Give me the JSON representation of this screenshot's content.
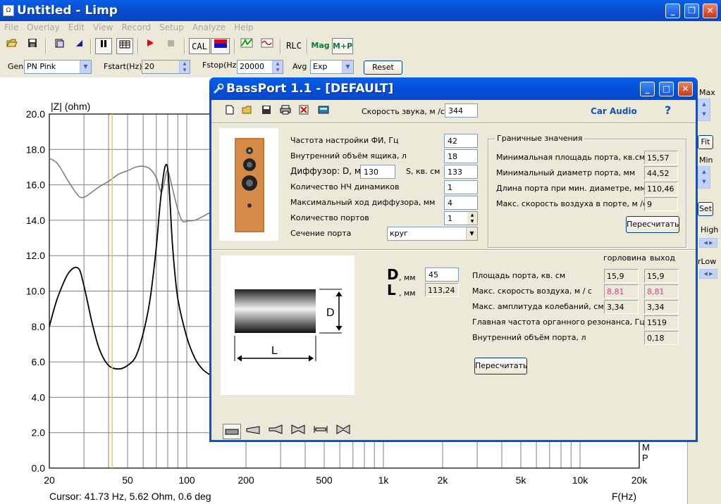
{
  "window": {
    "title": "Untitled - Limp",
    "minimize": "_",
    "maximize": "❐",
    "close": "✕"
  },
  "menu": [
    "File",
    "Overlay",
    "Edit",
    "View",
    "Record",
    "Setup",
    "Analyze",
    "Help"
  ],
  "toolbar": {
    "cal": "CAL",
    "rlc": "RLC",
    "mag": "Mag",
    "mp": "M+P"
  },
  "controls": {
    "gen_label": "Gen",
    "gen_value": "PN Pink",
    "fstart_label": "Fstart(Hz)",
    "fstart_value": "20",
    "fstop_label": "Fstop(Hz)",
    "fstop_value": "20000",
    "avg_label": "Avg",
    "avg_value": "Exp",
    "reset": "Reset"
  },
  "right_panel": {
    "max": "Max",
    "fit": "Fit",
    "min": "Min",
    "set": "Set",
    "high": "High",
    "low": "rLow"
  },
  "plot": {
    "ylabel": "|Z| (ohm)",
    "xlabel": "F(Hz)",
    "cursor": "Cursor: 41.73 Hz, 5.62 Ohm, 0.6 deg",
    "mp_m": "M",
    "mp_p": "P"
  },
  "chart_data": {
    "type": "line",
    "xscale": "log",
    "xlim": [
      20,
      20000
    ],
    "ylim": [
      0,
      20
    ],
    "x_ticks": [
      "20",
      "50",
      "100",
      "200",
      "500",
      "1k",
      "2k",
      "5k",
      "10k",
      "20k"
    ],
    "y_ticks": [
      "0.0",
      "2.0",
      "4.0",
      "6.0",
      "8.0",
      "10.0",
      "12.0",
      "14.0",
      "16.0",
      "18.0",
      "20.0"
    ],
    "cursor_x": 41.73,
    "series": [
      {
        "role": "magnitude",
        "color": "#000000",
        "x": [
          20,
          22,
          25,
          28,
          30,
          33,
          36,
          40,
          45,
          50,
          55,
          60,
          65,
          70,
          73,
          76,
          78,
          80,
          82,
          85,
          90,
          100,
          110,
          120,
          130,
          140,
          150,
          155
        ],
        "y": [
          8.0,
          9.6,
          11.0,
          11.3,
          10.3,
          8.2,
          6.7,
          5.8,
          5.6,
          5.8,
          6.3,
          7.6,
          9.5,
          12.5,
          14.8,
          16.5,
          17.1,
          16.9,
          15.2,
          12.3,
          9.6,
          7.4,
          6.2,
          5.6,
          5.3,
          5.15,
          5.05,
          5.0
        ]
      },
      {
        "role": "phase",
        "color": "#808080",
        "x": [
          20,
          22,
          25,
          28,
          30,
          33,
          36,
          40,
          45,
          50,
          55,
          60,
          65,
          70,
          74,
          77,
          80,
          85,
          90,
          95,
          100,
          110,
          120,
          130,
          140,
          150,
          155
        ],
        "y": [
          17.5,
          17.2,
          16.2,
          15.4,
          15.3,
          15.6,
          15.9,
          16.2,
          16.6,
          16.8,
          17.0,
          17.05,
          16.9,
          16.4,
          15.6,
          16.2,
          16.8,
          15.7,
          14.6,
          13.95,
          13.95,
          14.0,
          14.2,
          14.4,
          14.4,
          14.5,
          14.5
        ]
      }
    ]
  },
  "dialog": {
    "title": "BassPort 1.1 - [DEFAULT]",
    "sound_speed_label": "Скорость звука, м /с",
    "sound_speed": "344",
    "car_audio": "Car Audio",
    "help": "?",
    "params": {
      "tuning_label": "Частота настройки ФИ, Гц",
      "tuning": "42",
      "volume_label": "Внутренний объём ящика, л",
      "volume": "18",
      "diffuser_label": "Диффузор: D, мм",
      "diffuser_d": "130",
      "s_label": "S, кв. см",
      "s_value": "133",
      "woofers_label": "Количество НЧ динамиков",
      "woofers": "1",
      "xmax_label": "Максимальный ход диффузора, мм",
      "xmax": "4",
      "ports_label": "Количество портов",
      "ports": "1",
      "section_label": "Сечение порта",
      "section": "круг"
    },
    "limits": {
      "title": "Граничные значения",
      "min_area_label": "Минимальная площадь порта, кв.см",
      "min_area": "15,57",
      "min_diam_label": "Минимальный диаметр порта, мм",
      "min_diam": "44,52",
      "len_label": "Длина порта при мин. диаметре, мм",
      "len": "110,46",
      "vel_label": "Макс. скорость воздуха в порте, м /с",
      "vel": "9",
      "recalc": "Пересчитать"
    },
    "port": {
      "d_letter": "D",
      "d_unit": ", мм",
      "d_value": "45",
      "l_letter": "L",
      "l_unit": ", мм",
      "l_value": "113,24",
      "diagram_d": "D",
      "diagram_l": "L",
      "col_throat": "горловина",
      "col_exit": "выход",
      "area_label": "Площадь порта, кв. см",
      "area_throat": "15,9",
      "area_exit": "15,9",
      "speed_label": "Макс. скорость воздуха, м / с",
      "speed_throat": "8,81",
      "speed_exit": "8,81",
      "amp_label": "Макс. амплитуда колебаний, см",
      "amp_throat": "3,34",
      "amp_exit": "3,34",
      "res_label": "Главная частота органного резонанса, Гц",
      "res": "1519",
      "pvol_label": "Внутренний объём порта, л",
      "pvol": "0,18",
      "recalc": "Пересчитать"
    }
  }
}
